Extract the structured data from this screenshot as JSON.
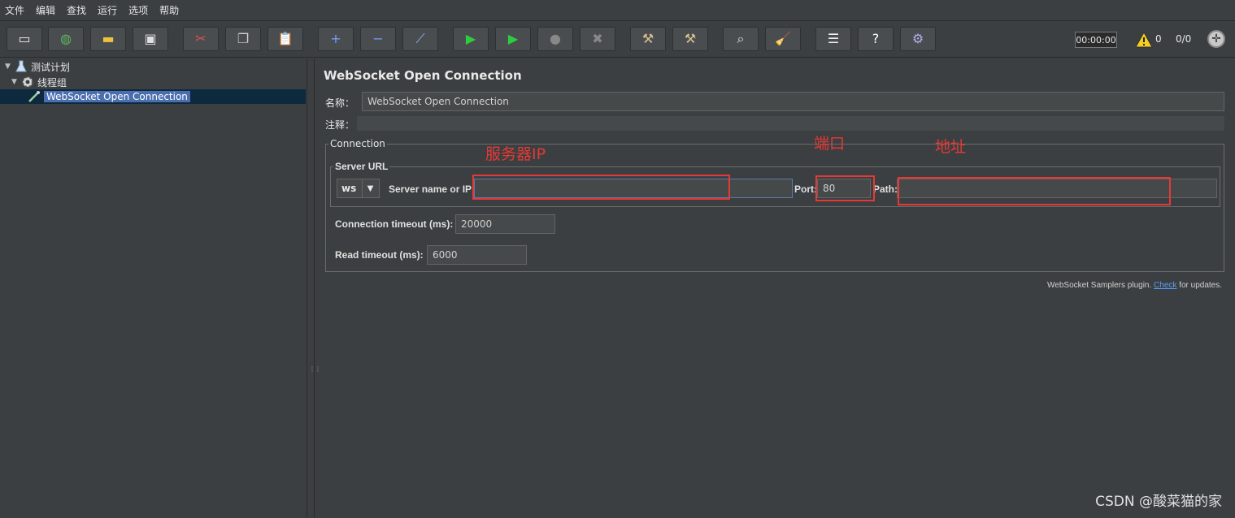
{
  "menu": [
    "文件",
    "编辑",
    "查找",
    "运行",
    "选项",
    "帮助"
  ],
  "toolbar": {
    "buttons": [
      {
        "name": "new-icon",
        "glyph": "▭",
        "color": "#f0f0f0"
      },
      {
        "name": "templates-icon",
        "glyph": "◍",
        "color": "#5cb85c"
      },
      {
        "name": "open-icon",
        "glyph": "▬",
        "color": "#f0c040"
      },
      {
        "name": "save-icon",
        "glyph": "▣",
        "color": "#e0e0e0"
      },
      {
        "name": "cut-icon",
        "glyph": "✂",
        "color": "#e05050"
      },
      {
        "name": "copy-icon",
        "glyph": "❐",
        "color": "#d0d0d0"
      },
      {
        "name": "paste-icon",
        "glyph": "📋",
        "color": "#e0c080"
      },
      {
        "name": "expand-icon",
        "glyph": "+",
        "color": "#6aa0f0"
      },
      {
        "name": "collapse-icon",
        "glyph": "−",
        "color": "#6aa0f0"
      },
      {
        "name": "toggle-icon",
        "glyph": "⟋",
        "color": "#8fb4e8"
      },
      {
        "name": "start-icon",
        "glyph": "▶",
        "color": "#2ecc40"
      },
      {
        "name": "start-no-pause-icon",
        "glyph": "▶",
        "color": "#2ecc40"
      },
      {
        "name": "stop-icon",
        "glyph": "●",
        "color": "#888888"
      },
      {
        "name": "shutdown-icon",
        "glyph": "✖",
        "color": "#888888"
      },
      {
        "name": "clear-icon",
        "glyph": "⚒",
        "color": "#d8c090"
      },
      {
        "name": "clear-all-icon",
        "glyph": "⚒",
        "color": "#d8c090"
      },
      {
        "name": "search-icon",
        "glyph": "⌕",
        "color": "#e0e0e0"
      },
      {
        "name": "reset-search-icon",
        "glyph": "🧹",
        "color": "#f0c040"
      },
      {
        "name": "function-helper-icon",
        "glyph": "☰",
        "color": "#f0f0f0"
      },
      {
        "name": "help-icon",
        "glyph": "?",
        "color": "#ffffff"
      },
      {
        "name": "remote-start-icon",
        "glyph": "⚙",
        "color": "#b0b0f0"
      }
    ],
    "timer": "00:00:00",
    "warning_count": "0",
    "thread_count": "0/0"
  },
  "tree": {
    "items": [
      {
        "label": "测试计划",
        "icon": "test-plan-icon"
      },
      {
        "label": "线程组",
        "icon": "thread-group-icon"
      },
      {
        "label": "WebSocket Open Connection",
        "icon": "sampler-icon"
      }
    ]
  },
  "panel": {
    "title": "WebSocket Open Connection",
    "name_label": "名称：",
    "name_value": "WebSocket Open Connection",
    "comment_label": "注释：",
    "connection_legend": "Connection",
    "server_url_legend": "Server URL",
    "protocol_value": "ws",
    "server_label": "Server name or IP:",
    "server_value": "",
    "port_label": "Port:",
    "port_value": "80",
    "path_label": "Path:",
    "path_value": "",
    "conn_timeout_label": "Connection timeout (ms):",
    "conn_timeout_value": "20000",
    "read_timeout_label": "Read timeout (ms):",
    "read_timeout_value": "6000",
    "plugin_note_prefix": "WebSocket Samplers plugin. ",
    "plugin_note_link": "Check",
    "plugin_note_suffix": " for updates."
  },
  "annotations": {
    "server_ip": "服务器IP",
    "port": "端口",
    "path": "地址",
    "color": "#e53935"
  },
  "watermark": "CSDN @酸菜猫的家"
}
